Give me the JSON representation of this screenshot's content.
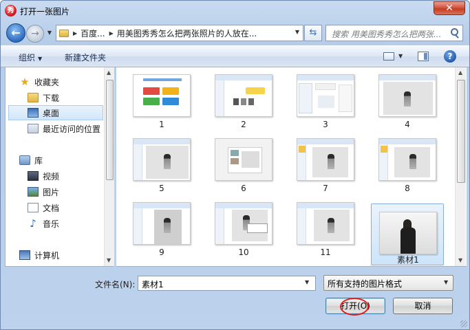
{
  "window": {
    "title": "打开一张图片",
    "app_icon_glyph": "秀",
    "close_glyph": "✕"
  },
  "address": {
    "crumbs": [
      "百度...",
      "用美图秀秀怎么把两张照片的人放在..."
    ],
    "search_placeholder": "搜索 用美图秀秀怎么把两张..."
  },
  "toolbar": {
    "organize_label": "组织",
    "new_folder_label": "新建文件夹",
    "help_glyph": "?"
  },
  "nav": {
    "items": [
      {
        "label": "收藏夹",
        "icon": "star-icon"
      },
      {
        "label": "下载",
        "icon": "downloads-folder-icon"
      },
      {
        "label": "桌面",
        "icon": "desktop-icon",
        "selected": true
      },
      {
        "label": "最近访问的位置",
        "icon": "recent-places-icon"
      },
      {
        "label": "库",
        "icon": "library-icon"
      },
      {
        "label": "视频",
        "icon": "video-icon"
      },
      {
        "label": "图片",
        "icon": "pictures-icon"
      },
      {
        "label": "文档",
        "icon": "documents-icon"
      },
      {
        "label": "音乐",
        "icon": "music-icon"
      },
      {
        "label": "计算机",
        "icon": "computer-icon"
      }
    ]
  },
  "files": [
    {
      "name": "1"
    },
    {
      "name": "2"
    },
    {
      "name": "3"
    },
    {
      "name": "4"
    },
    {
      "name": "5"
    },
    {
      "name": "6"
    },
    {
      "name": "7"
    },
    {
      "name": "8"
    },
    {
      "name": "9"
    },
    {
      "name": "10"
    },
    {
      "name": "11"
    },
    {
      "name": "素材1",
      "selected": true
    }
  ],
  "footer": {
    "filename_label": "文件名(N):",
    "filename_value": "素材1",
    "filetype_value": "所有支持的图片格式",
    "open_label": "打开(O)",
    "cancel_label": "取消"
  },
  "colors": {
    "accent": "#2d6cc0",
    "selection": "#cde4fa",
    "annotation": "#e0221e"
  }
}
